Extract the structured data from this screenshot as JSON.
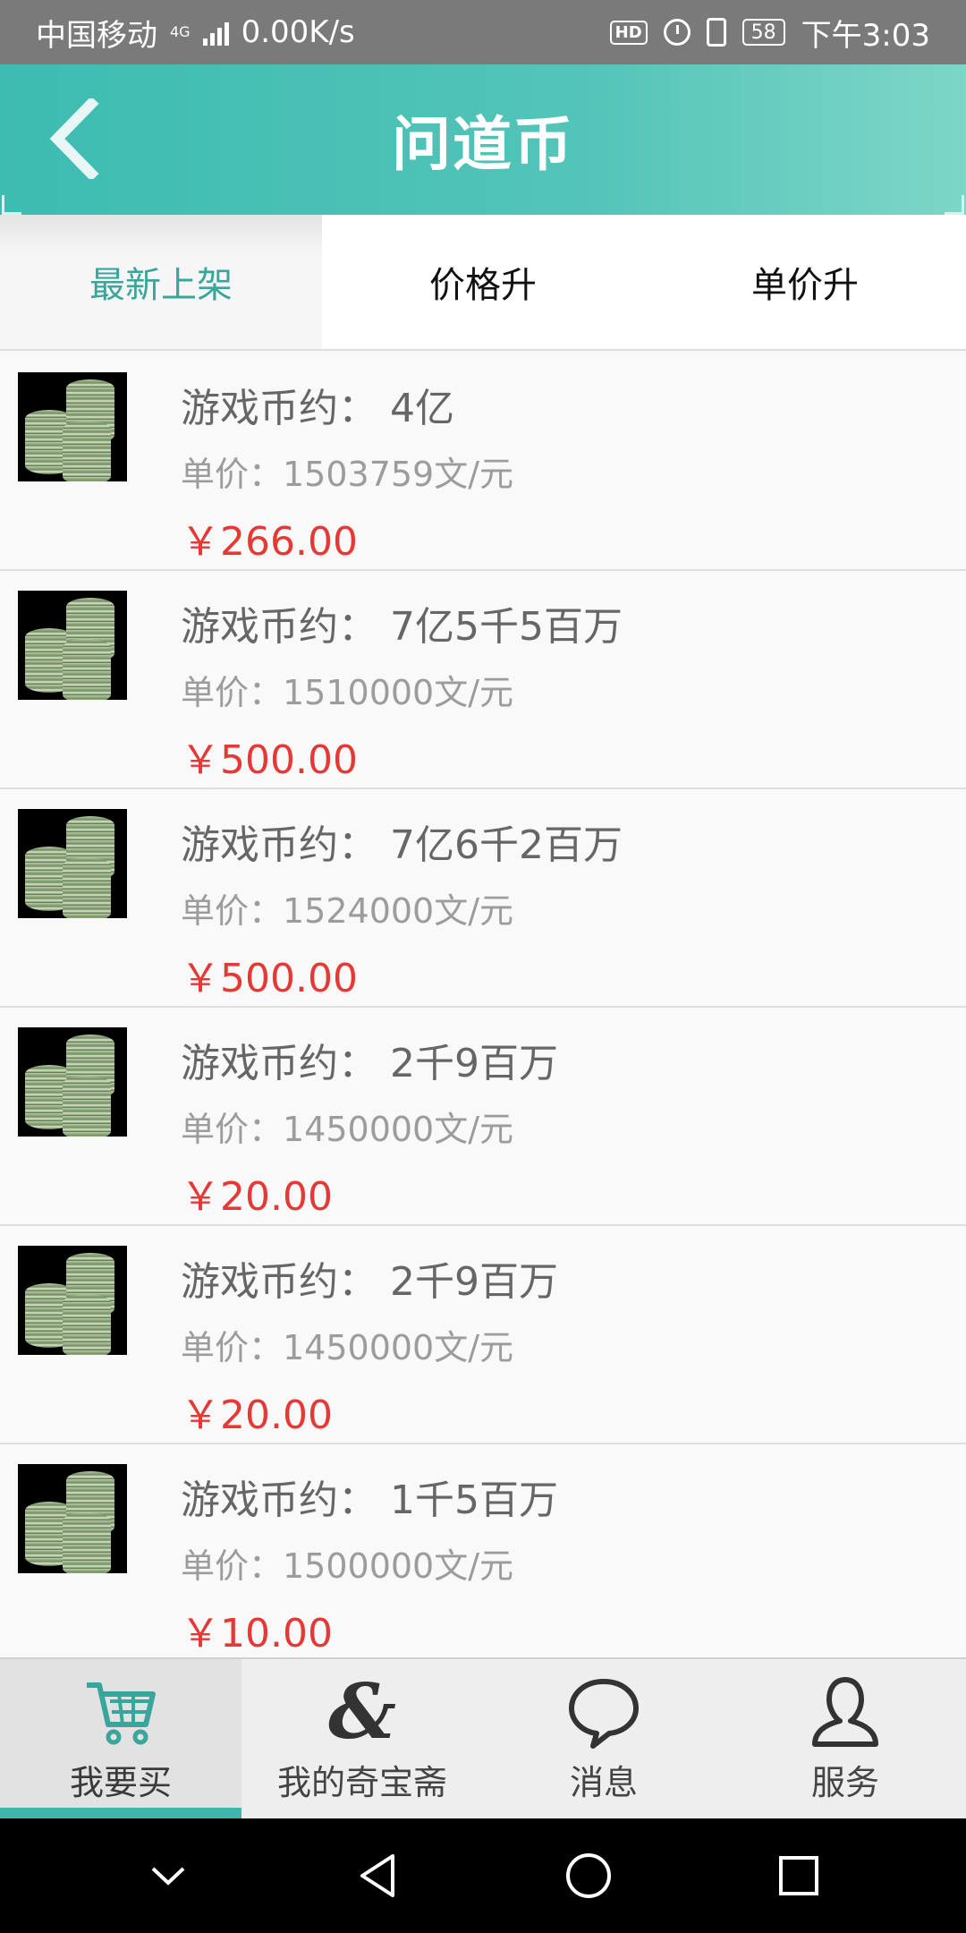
{
  "status_bar": {
    "carrier": "中国移动",
    "network_type": "4G",
    "speed": "0.00K/s",
    "battery": "58",
    "time": "下午3:03"
  },
  "header": {
    "title": "问道币",
    "back_icon": "chevron-left-icon"
  },
  "tabs": [
    {
      "label": "最新上架",
      "active": true
    },
    {
      "label": "价格升",
      "active": false
    },
    {
      "label": "单价升",
      "active": false
    }
  ],
  "listings": [
    {
      "amount": "游戏币约： 4亿",
      "unit_price": "单价：1503759文/元",
      "price": "￥266.00"
    },
    {
      "amount": "游戏币约： 7亿5千5百万",
      "unit_price": "单价：1510000文/元",
      "price": "￥500.00"
    },
    {
      "amount": "游戏币约： 7亿6千2百万",
      "unit_price": "单价：1524000文/元",
      "price": "￥500.00"
    },
    {
      "amount": "游戏币约： 2千9百万",
      "unit_price": "单价：1450000文/元",
      "price": "￥20.00"
    },
    {
      "amount": "游戏币约： 2千9百万",
      "unit_price": "单价：1450000文/元",
      "price": "￥20.00"
    },
    {
      "amount": "游戏币约： 1千5百万",
      "unit_price": "单价：1500000文/元",
      "price": "￥10.00"
    }
  ],
  "bottom_nav": [
    {
      "label": "我要买",
      "icon": "cart-icon",
      "active": true
    },
    {
      "label": "我的奇宝斋",
      "icon": "ampersand-icon",
      "active": false
    },
    {
      "label": "消息",
      "icon": "chat-bubble-icon",
      "active": false
    },
    {
      "label": "服务",
      "icon": "user-icon",
      "active": false
    }
  ],
  "colors": {
    "header_teal": "#4ec2b6",
    "accent": "#3aa69b",
    "price_red": "#e53935"
  }
}
